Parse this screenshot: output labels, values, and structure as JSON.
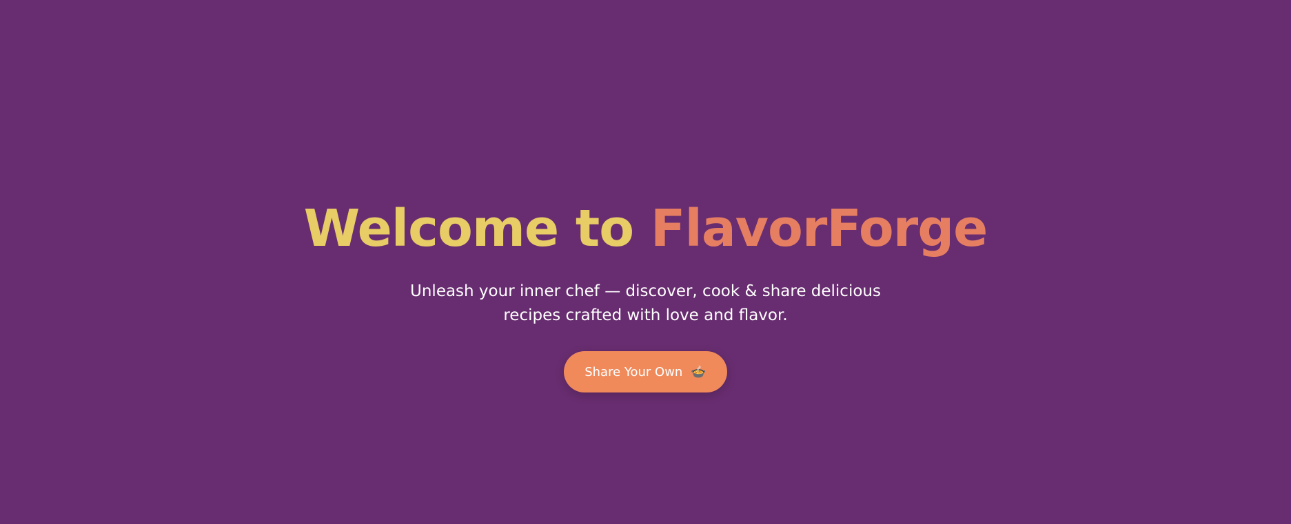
{
  "hero": {
    "title_part1": "Welcome to",
    "title_part2": "FlavorForge",
    "subtitle": "Unleash your inner chef — discover, cook & share delicious recipes crafted with love and flavor.",
    "cta_label": "Share Your Own",
    "cta_icon": "🍲"
  },
  "colors": {
    "background": "#682d70",
    "title_primary": "#e8cc66",
    "title_accent": "#e67f62",
    "cta": "#f08a5b"
  }
}
